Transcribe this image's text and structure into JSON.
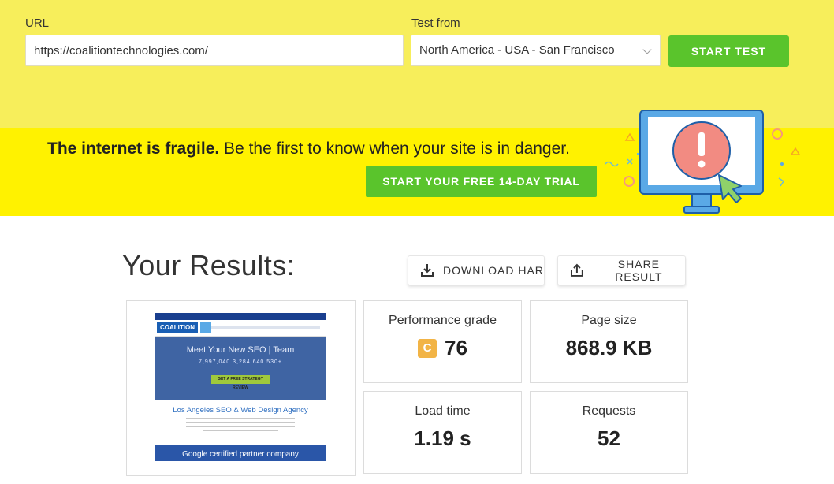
{
  "form": {
    "url_label": "URL",
    "url_value": "https://coalitiontechnologies.com/",
    "test_from_label": "Test from",
    "test_from_value": "North America - USA - San Francisco",
    "start_button": "START TEST"
  },
  "promo": {
    "bold_text": "The internet is fragile.",
    "text": " Be the first to know when your site is in danger.",
    "trial_button": "START YOUR FREE 14-DAY TRIAL"
  },
  "results": {
    "title": "Your Results:",
    "download_button": "DOWNLOAD HAR",
    "share_button": "SHARE RESULT",
    "performance": {
      "label": "Performance grade",
      "grade": "C",
      "score": "76"
    },
    "page_size": {
      "label": "Page size",
      "value": "868.9 KB"
    },
    "load_time": {
      "label": "Load time",
      "value": "1.19 s"
    },
    "requests": {
      "label": "Requests",
      "value": "52"
    }
  },
  "thumbnail": {
    "logo": "COALITION",
    "hero_title": "Meet Your New SEO | Team",
    "stats": "7,997,040    3,284,640    530+",
    "cta": "GET A FREE STRATEGY REVIEW",
    "subtitle": "Los Angeles SEO & Web Design Agency",
    "footer": "Google certified partner company"
  },
  "colors": {
    "top_band": "#f7ee5b",
    "promo_band": "#fff200",
    "accent_green": "#5ac42c",
    "grade_badge": "#f2b446"
  }
}
